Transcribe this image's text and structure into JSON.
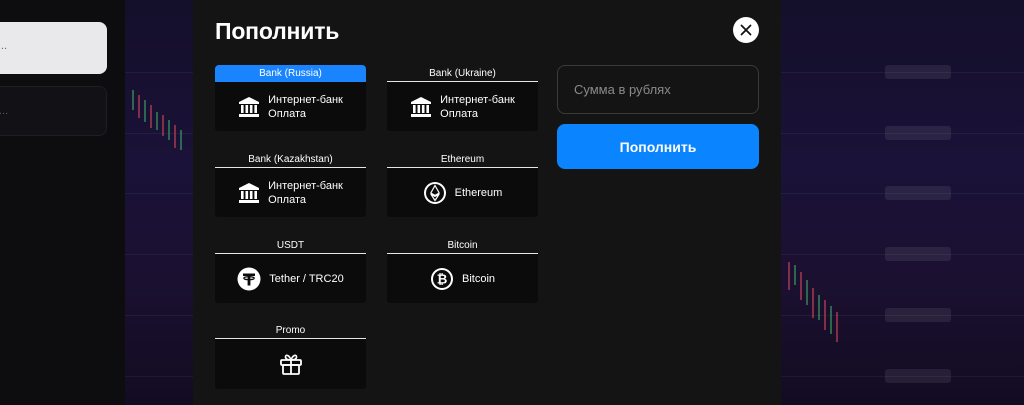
{
  "background": {
    "left_card_text": "...",
    "left_card2_text": "..."
  },
  "modal": {
    "title": "Пополнить",
    "close_icon": "close-icon"
  },
  "methods": [
    {
      "label": "Bank (Russia)",
      "name": "Интернет-банк",
      "subname": "Оплата",
      "icon": "bank-icon",
      "active": true
    },
    {
      "label": "Bank (Ukraine)",
      "name": "Интернет-банк",
      "subname": "Оплата",
      "icon": "bank-icon",
      "active": false
    },
    {
      "label": "Bank (Kazakhstan)",
      "name": "Интернет-банк",
      "subname": "Оплата",
      "icon": "bank-icon",
      "active": false
    },
    {
      "label": "Ethereum",
      "name": "Ethereum",
      "subname": "",
      "icon": "ethereum-icon",
      "active": false
    },
    {
      "label": "USDT",
      "name": "Tether / TRC20",
      "subname": "",
      "icon": "tether-icon",
      "active": false
    },
    {
      "label": "Bitcoin",
      "name": "Bitcoin",
      "subname": "",
      "icon": "bitcoin-icon",
      "active": false
    },
    {
      "label": "Promo",
      "name": "",
      "subname": "",
      "icon": "gift-icon",
      "active": false
    }
  ],
  "amount": {
    "placeholder": "Сумма в рублях",
    "value": ""
  },
  "submit": {
    "label": "Пополнить"
  },
  "colors": {
    "accent": "#0a84ff",
    "active_tab": "#1a84ff",
    "modal_bg": "#141414",
    "card_bg": "#0b0b0b"
  }
}
